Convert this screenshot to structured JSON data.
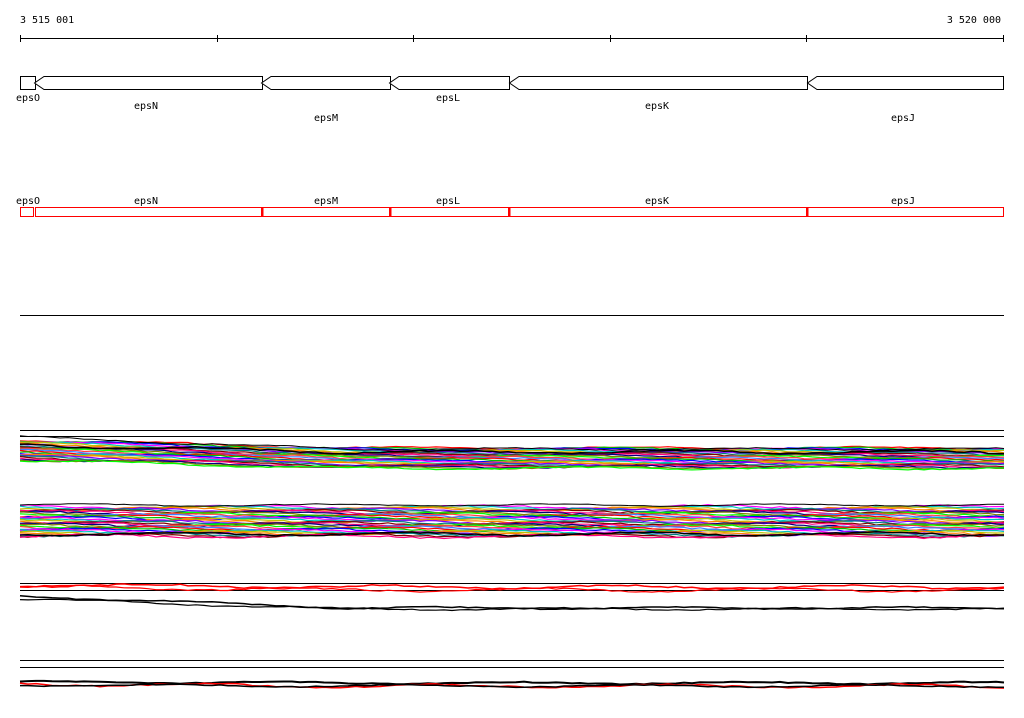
{
  "ruler": {
    "start_label": "3 515 001",
    "end_label": "3 520 000"
  },
  "genes": [
    {
      "name": "epsO",
      "strand": "-"
    },
    {
      "name": "epsN",
      "strand": "-"
    },
    {
      "name": "epsM",
      "strand": "-"
    },
    {
      "name": "epsL",
      "strand": "-"
    },
    {
      "name": "epsK",
      "strand": "-"
    },
    {
      "name": "epsJ",
      "strand": "-"
    }
  ],
  "colors": {
    "gene_outline": "#000000",
    "transcript_outline": "#ff0000",
    "track_palette": [
      "#ff0000",
      "#00c000",
      "#0000ff",
      "#ff00ff",
      "#00c0c0",
      "#c0c000",
      "#ff8000",
      "#8000ff",
      "#008080",
      "#800000",
      "#ff0080",
      "#000080",
      "#808000",
      "#00ff00",
      "#ff4040",
      "#4080ff"
    ]
  }
}
